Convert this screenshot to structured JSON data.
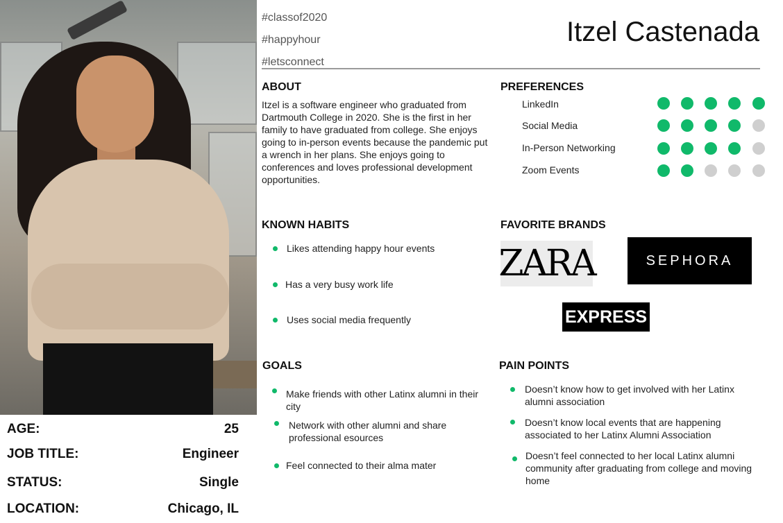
{
  "hashtags": [
    "#classof2020",
    "#happyhour",
    "#letsconnect"
  ],
  "name": "Itzel Castenada",
  "profile": {
    "age_label": "AGE:",
    "age": "25",
    "job_label": "JOB TITLE:",
    "job": "Engineer",
    "status_label": "STATUS:",
    "status": "Single",
    "location_label": "LOCATION:",
    "location": "Chicago, IL"
  },
  "about": {
    "heading": "ABOUT",
    "text": "Itzel is a software engineer who graduated from Dartmouth College in 2020. She is the first in her family to have graduated from college. She enjoys going to in-person events because the pandemic put a wrench in her plans. She enjoys going to conferences and loves professional development opportunities."
  },
  "preferences": {
    "heading": "PREFERENCES",
    "max": 5,
    "active_color": "#10b96a",
    "inactive_color": "#cfcfcf",
    "items": [
      {
        "label": "LinkedIn",
        "score": 5
      },
      {
        "label": "Social Media",
        "score": 4
      },
      {
        "label": "In-Person Networking",
        "score": 4
      },
      {
        "label": "Zoom Events",
        "score": 2
      }
    ]
  },
  "habits": {
    "heading": "KNOWN HABITS",
    "items": [
      "Likes attending happy hour events",
      "Has a very busy work life",
      "Uses social media frequently"
    ]
  },
  "brands": {
    "heading": "FAVORITE BRANDS",
    "items": [
      "ZARA",
      "SEPHORA",
      "EXPRESS"
    ]
  },
  "goals": {
    "heading": "GOALS",
    "items": [
      "Make friends with other Latinx alumni in their city",
      "Network with other alumni and share professional esources",
      "Feel connected to their alma mater"
    ]
  },
  "pain_points": {
    "heading": "PAIN POINTS",
    "items": [
      "Doesn’t know how to get involved with her Latinx alumni association",
      "Doesn’t know local events that are happening associated to her Latinx Alumni Association",
      "Doesn’t feel connected to her local Latinx alumni community after graduating from college and moving home"
    ]
  }
}
